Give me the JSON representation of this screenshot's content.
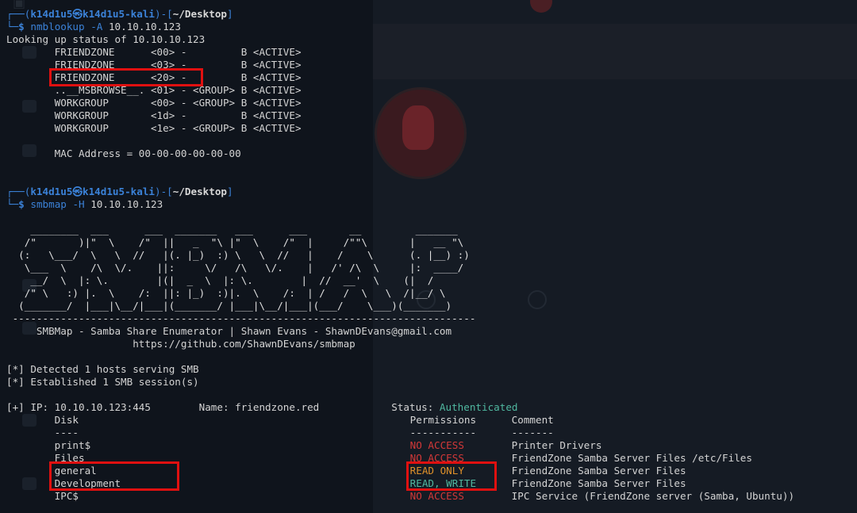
{
  "prompt1": {
    "frame_top": "┌──(",
    "user": "k14d1u5",
    "at": "㉿",
    "host": "k14d1u5-kali",
    "mid": ")-[",
    "path": "~/Desktop",
    "end": "]",
    "frame_bottom": "└─",
    "dollar": "$",
    "command": "nmblookup",
    "args": " -A ",
    "target": "10.10.10.123"
  },
  "nmb_header": "Looking up status of 10.10.10.123",
  "nmb_rows": [
    "        FRIENDZONE      <00> -         B <ACTIVE>",
    "        FRIENDZONE      <03> -         B <ACTIVE>",
    "        FRIENDZONE      <20> -         B <ACTIVE>",
    "        ..__MSBROWSE__. <01> - <GROUP> B <ACTIVE>",
    "        WORKGROUP       <00> - <GROUP> B <ACTIVE>",
    "        WORKGROUP       <1d> -         B <ACTIVE>",
    "        WORKGROUP       <1e> - <GROUP> B <ACTIVE>"
  ],
  "mac_line": "        MAC Address = 00-00-00-00-00-00",
  "prompt2": {
    "frame_top": "┌──(",
    "user": "k14d1u5",
    "at": "㉿",
    "host": "k14d1u5-kali",
    "mid": ")-[",
    "path": "~/Desktop",
    "end": "]",
    "frame_bottom": "└─",
    "dollar": "$",
    "command": "smbmap",
    "args": " -H ",
    "target": "10.10.10.123"
  },
  "smbmap_banner": [
    "    ________  ___      ___  _______   ___      ___       __         _______",
    "   /\"       )|\"  \\    /\"  ||   _  \"\\ |\"  \\    /\"  |     /\"\"\\       |   __ \"\\",
    "  (:   \\___/  \\   \\  //   |(. |_)  :) \\   \\  //   |    /    \\      (. |__) :)",
    "   \\___  \\    /\\  \\/.    ||:     \\/   /\\   \\/.    |   /' /\\  \\     |:  ____/",
    "    __/  \\  |: \\.        |(|  _  \\  |: \\.        |  //  __'  \\    (|  /",
    "   /\" \\   :) |.  \\    /:  ||: |_)  :)|.  \\    /:  | /   /  \\   \\  /|__/ \\",
    "  (_______/  |___|\\__/|___|(_______/ |___|\\__/|___|(___/    \\___)(_______)",
    " -----------------------------------------------------------------------------"
  ],
  "smbmap_title": "     SMBMap - Samba Share Enumerator | Shawn Evans - ShawnDEvans@gmail.com",
  "smbmap_url": "                     https://github.com/ShawnDEvans/smbmap",
  "info_lines": [
    "[*] Detected 1 hosts serving SMB",
    "[*] Established 1 SMB session(s)"
  ],
  "ip_line": {
    "prefix": "[+] IP: 10.10.10.123:445        Name: friendzone.red            Status: ",
    "status": "Authenticated"
  },
  "table_header": {
    "disk": "Disk",
    "permissions": "Permissions",
    "comment": "Comment"
  },
  "table_sep": {
    "disk": "----",
    "permissions": "-----------",
    "comment": "-------"
  },
  "shares": [
    {
      "disk": "print$",
      "perm": "NO ACCESS",
      "comment": "Printer Drivers",
      "level": "none"
    },
    {
      "disk": "Files",
      "perm": "NO ACCESS",
      "comment": "FriendZone Samba Server Files /etc/Files",
      "level": "none"
    },
    {
      "disk": "general",
      "perm": "READ ONLY",
      "comment": "FriendZone Samba Server Files",
      "level": "read"
    },
    {
      "disk": "Development",
      "perm": "READ, WRITE",
      "comment": "FriendZone Samba Server Files",
      "level": "write"
    },
    {
      "disk": "IPC$",
      "perm": "NO ACCESS",
      "comment": "IPC Service (FriendZone server (Samba, Ubuntu))",
      "level": "none"
    }
  ],
  "colors": {
    "prompt": "#3b82d8",
    "authenticated": "#50b8a0",
    "no_access": "#d23838",
    "read_only": "#e0912a",
    "read_write": "#50b8a0",
    "highlight_box": "#e01010"
  }
}
